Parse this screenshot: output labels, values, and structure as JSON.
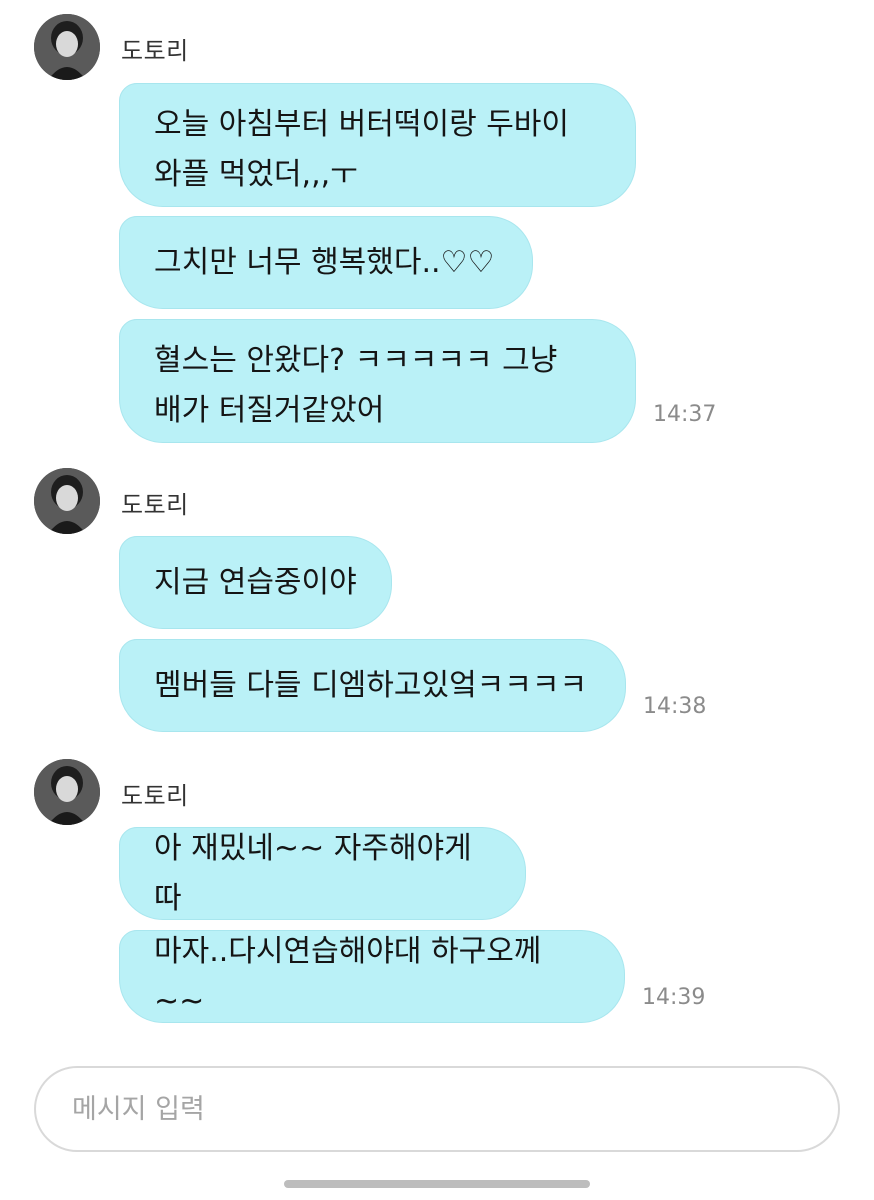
{
  "groups": [
    {
      "sender": "도토리",
      "messages": [
        "오늘 아침부터 버터떡이랑 두바이\n와플 먹었더,,,ㅜ",
        "그치만 너무 행복했다..♡♡",
        "혈스는 안왔다?  ㅋㅋㅋㅋㅋ 그냥\n배가 터질거같았어"
      ],
      "time": "14:37"
    },
    {
      "sender": "도토리",
      "messages": [
        "지금 연습중이야",
        "멤버들 다들 디엠하고있엌ㅋㅋㅋㅋ"
      ],
      "time": "14:38"
    },
    {
      "sender": "도토리",
      "messages": [
        "아 재밌네~~ 자주해야게따",
        "마자..다시연습해야대 하구오께~~"
      ],
      "time": "14:39"
    }
  ],
  "input": {
    "placeholder": "메시지 입력"
  },
  "icons": {
    "avatar": "profile-photo-grayscale"
  },
  "colors": {
    "bubble": "#baf1f7",
    "timestamp": "#8b8b8b"
  }
}
